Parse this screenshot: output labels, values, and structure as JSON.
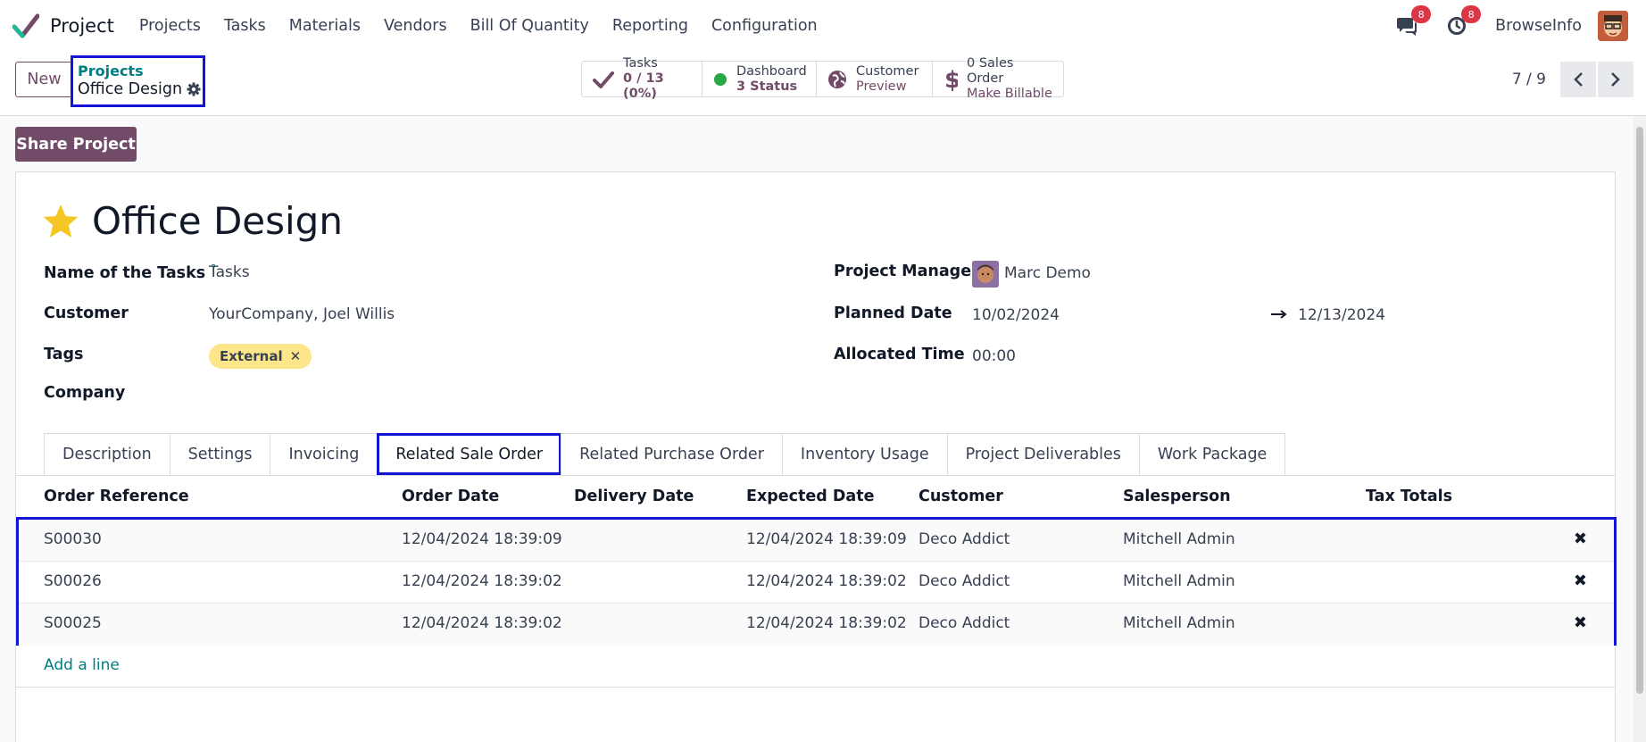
{
  "navbar": {
    "app_name": "Project",
    "menu": [
      "Projects",
      "Tasks",
      "Materials",
      "Vendors",
      "Bill Of Quantity",
      "Reporting",
      "Configuration"
    ],
    "messages_count": "8",
    "activities_count": "8",
    "user_name": "BrowseInfo"
  },
  "control": {
    "new_label": "New",
    "breadcrumb_parent": "Projects",
    "breadcrumb_current": "Office Design",
    "stats": {
      "tasks_label": "Tasks",
      "tasks_value": "0 / 13 (0%)",
      "dashboard_label": "Dashboard",
      "dashboard_value": "3 Status",
      "customer_label": "Customer",
      "customer_value": "Preview",
      "sales_label": "0 Sales Order",
      "sales_value": "Make Billable"
    },
    "pager": "7 / 9"
  },
  "share_label": "Share Project",
  "form": {
    "title": "Office Design",
    "fields": {
      "name_tasks_label": "Name of the Tasks",
      "name_tasks_help": "?",
      "name_tasks_value": "Tasks",
      "customer_label": "Customer",
      "customer_value": "YourCompany, Joel Willis",
      "tags_label": "Tags",
      "tag_value": "External",
      "company_label": "Company",
      "pm_label": "Project Manager",
      "pm_value": "Marc Demo",
      "planned_label": "Planned Date",
      "planned_start": "10/02/2024",
      "planned_end": "12/13/2024",
      "allocated_label": "Allocated Time",
      "allocated_value": "00:00"
    },
    "tabs": [
      "Description",
      "Settings",
      "Invoicing",
      "Related Sale Order",
      "Related Purchase Order",
      "Inventory Usage",
      "Project Deliverables",
      "Work Package"
    ],
    "active_tab": "Related Sale Order",
    "table": {
      "headers": [
        "Order Reference",
        "Order Date",
        "Delivery Date",
        "Expected Date",
        "Customer",
        "Salesperson",
        "Tax Totals"
      ],
      "rows": [
        {
          "ref": "S00030",
          "order_date": "12/04/2024 18:39:09",
          "delivery": "",
          "expected": "12/04/2024 18:39:09",
          "customer": "Deco Addict",
          "salesperson": "Mitchell Admin"
        },
        {
          "ref": "S00026",
          "order_date": "12/04/2024 18:39:02",
          "delivery": "",
          "expected": "12/04/2024 18:39:02",
          "customer": "Deco Addict",
          "salesperson": "Mitchell Admin"
        },
        {
          "ref": "S00025",
          "order_date": "12/04/2024 18:39:02",
          "delivery": "",
          "expected": "12/04/2024 18:39:02",
          "customer": "Deco Addict",
          "salesperson": "Mitchell Admin"
        }
      ],
      "add_line": "Add a line",
      "delete_glyph": "✖"
    }
  },
  "colors": {
    "brand": "#714b67",
    "link": "#017e84",
    "highlight": "#1414d6",
    "badge": "#dc3545",
    "tag": "#fde68a",
    "star": "#f3c623"
  },
  "icons": [
    "project-logo",
    "chat-icon",
    "clock-icon",
    "gear-icon",
    "check-icon",
    "status-dot-icon",
    "globe-icon",
    "dollar-icon",
    "chevron-left-icon",
    "chevron-right-icon",
    "star-icon",
    "arrow-right-icon",
    "close-icon"
  ]
}
